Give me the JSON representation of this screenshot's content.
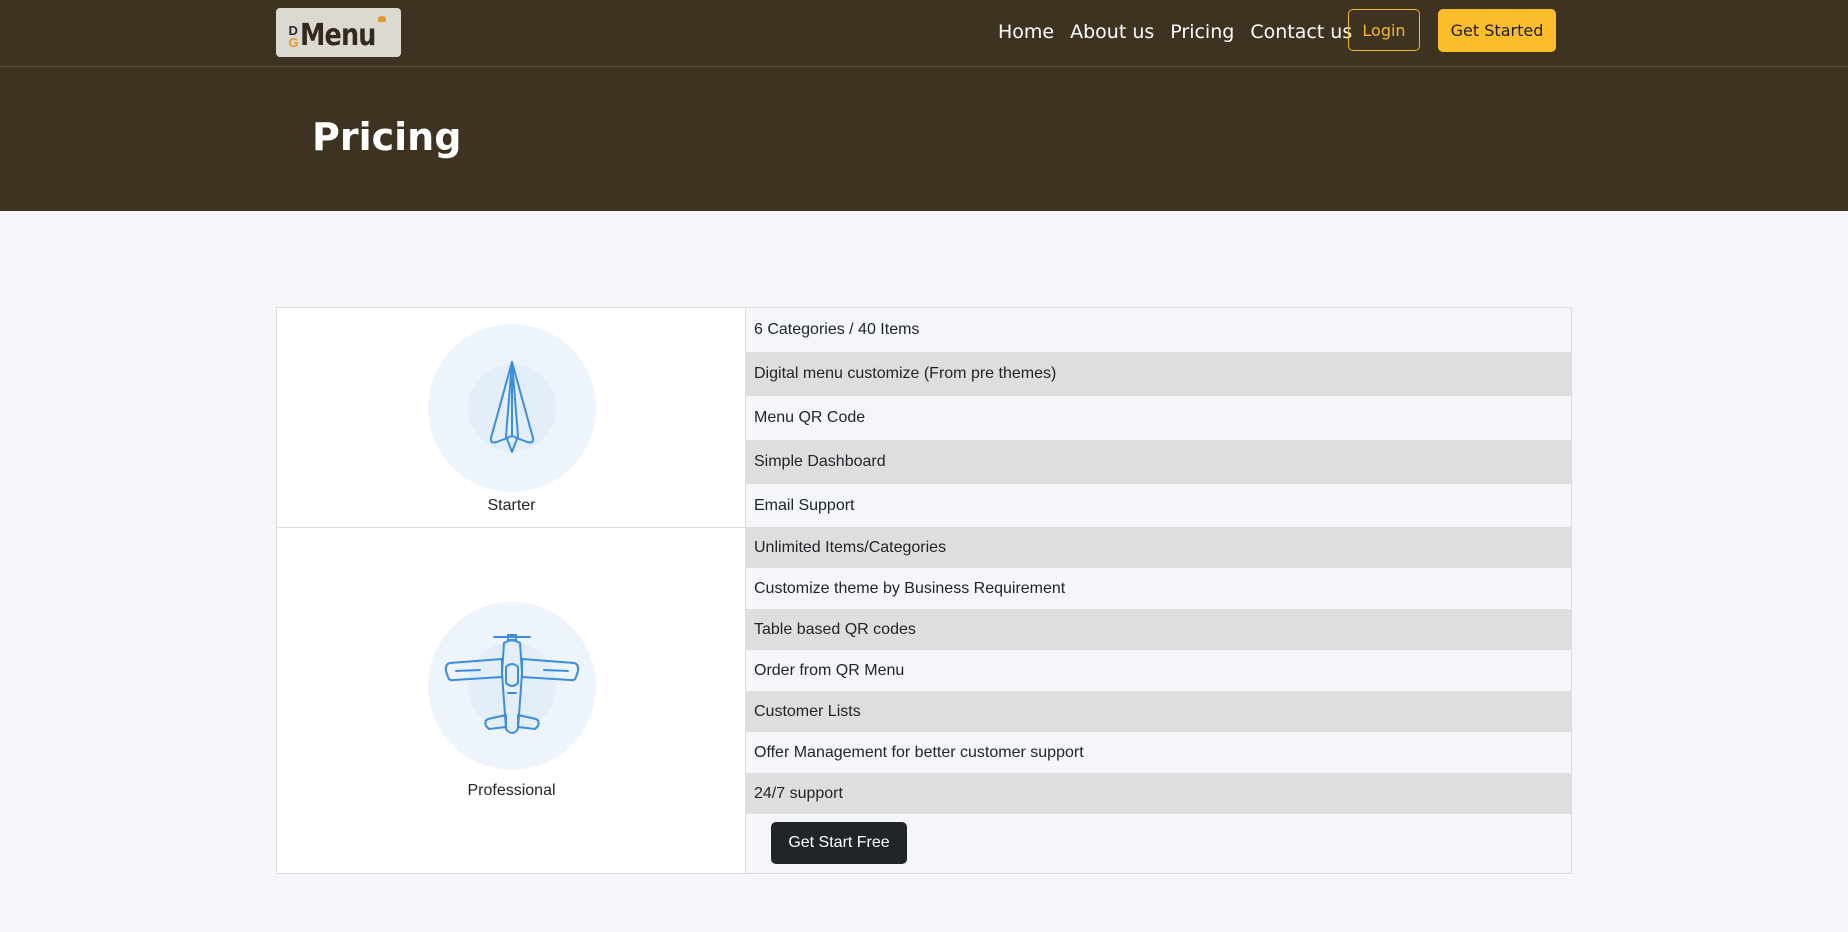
{
  "brand": {
    "logo_dg_top": "D",
    "logo_dg_bottom": "G",
    "logo_word": "Menu",
    "accent": "#f5b927",
    "header_bg": "#3e3221"
  },
  "nav": {
    "links": [
      "Home",
      "About us",
      "Pricing",
      "Contact us"
    ],
    "login_label": "Login",
    "get_started_label": "Get Started"
  },
  "hero": {
    "title": "Pricing"
  },
  "plans": [
    {
      "name": "Starter",
      "icon": "paper-plane-icon",
      "features": [
        "6 Categories / 40 Items",
        "Digital menu customize (From pre themes)",
        "Menu QR Code",
        "Simple Dashboard",
        "Email Support"
      ]
    },
    {
      "name": "Professional",
      "icon": "airplane-icon",
      "features": [
        "Unlimited Items/Categories",
        "Customize theme by Business Requirement",
        "Table based QR codes",
        "Order from QR Menu",
        "Customer Lists",
        "Offer Management for better customer support",
        "24/7 support"
      ],
      "cta_label": "Get Start Free"
    }
  ]
}
